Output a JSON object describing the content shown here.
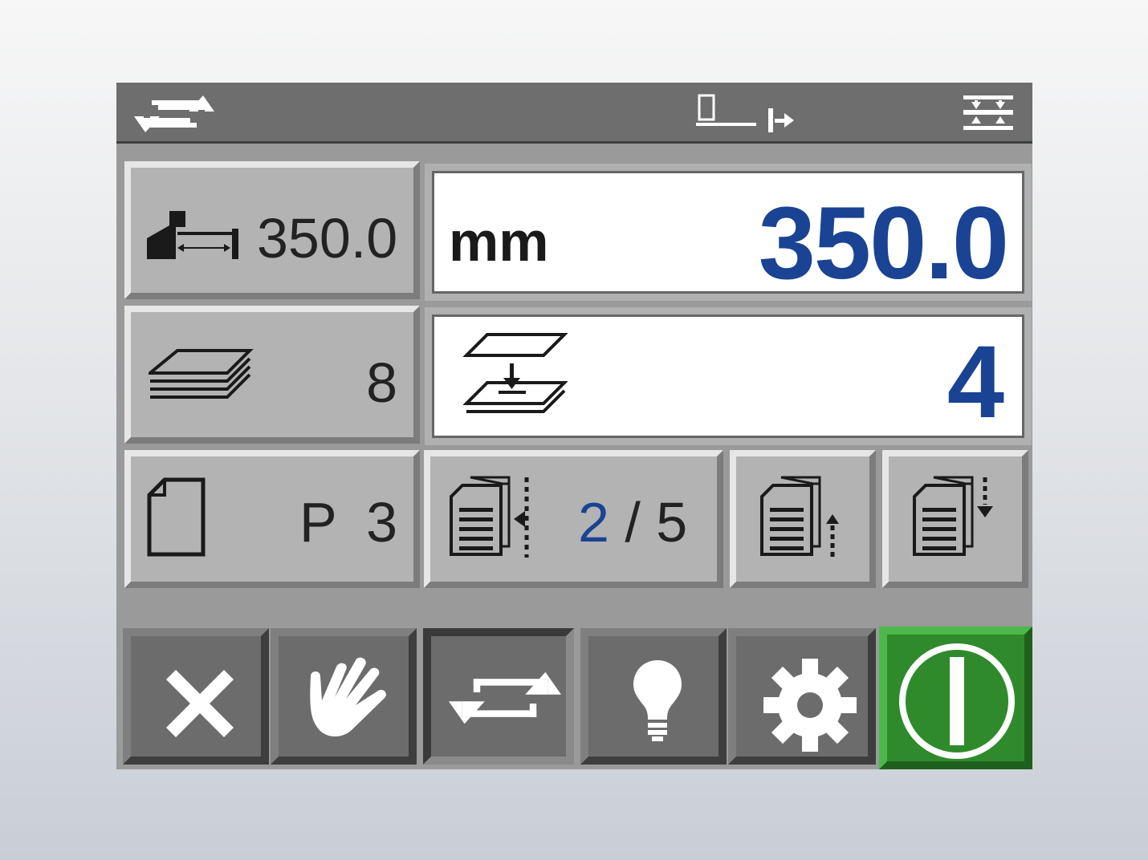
{
  "status_bar": {
    "icons": [
      "cycle-icon",
      "paper-edge-icon",
      "push-forward-icon",
      "press-beam-icon"
    ]
  },
  "cut_position": {
    "value": "350.0",
    "icon": "backgauge-distance-icon"
  },
  "measurement": {
    "unit": "mm",
    "value": "350.0"
  },
  "stack_count": {
    "value": "8",
    "icon": "paper-stack-icon"
  },
  "sheets_per_cycle": {
    "value": "4",
    "icon": "sheet-transfer-icon"
  },
  "program": {
    "prefix": "P",
    "number": "3",
    "icon": "blank-page-icon"
  },
  "step": {
    "current": "2",
    "separator": "/",
    "total": "5",
    "icon": "document-step-icon"
  },
  "step_controls": {
    "up_icon": "document-arrow-up-icon",
    "down_icon": "document-arrow-down-icon"
  },
  "bottom_bar": {
    "buttons": [
      "cancel",
      "manual",
      "cycle",
      "light",
      "settings",
      "power"
    ],
    "colors": {
      "power": "#2f8a2b",
      "value_blue": "#1a4393"
    }
  }
}
